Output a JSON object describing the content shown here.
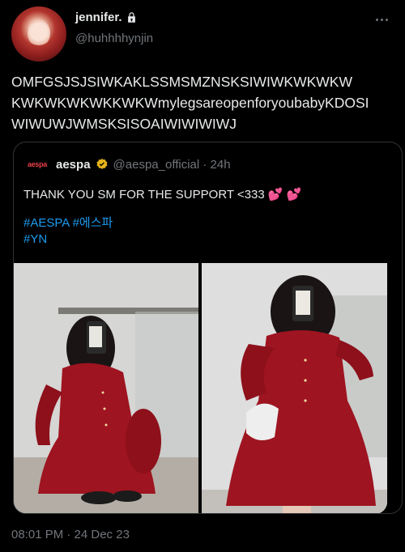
{
  "author": {
    "display_name": "jennifer.",
    "handle": "@huhhhhynjin"
  },
  "tweet": {
    "lines": [
      "OMFGSJSJSIWKAKLSSMSMZNSKSIWIWKWKWKW",
      "KWKWKWKWKKWKWmylegsareopenforyoubabyKDOSI",
      "WIWUWJWMSKSISOAIWIWIWIWJ"
    ],
    "timestamp": "08:01 PM · 24 Dec 23"
  },
  "quoted": {
    "avatar_text": "aespa",
    "display_name": "aespa",
    "handle_time": "@aespa_official · 24h",
    "text": "THANK YOU SM FOR THE SUPPORT <333 ",
    "emoji": "💕 💕",
    "hashtags_line1": "#AESPA #에스파",
    "hashtags_line2": "#YN"
  },
  "colors": {
    "background": "#000000",
    "text": "#e7e9ea",
    "secondary": "#71767b",
    "link": "#1d9bf0",
    "verified": "#e8b51b",
    "dress": "#9e1420"
  },
  "icons": [
    "lock-icon",
    "more-icon",
    "verified-icon"
  ]
}
